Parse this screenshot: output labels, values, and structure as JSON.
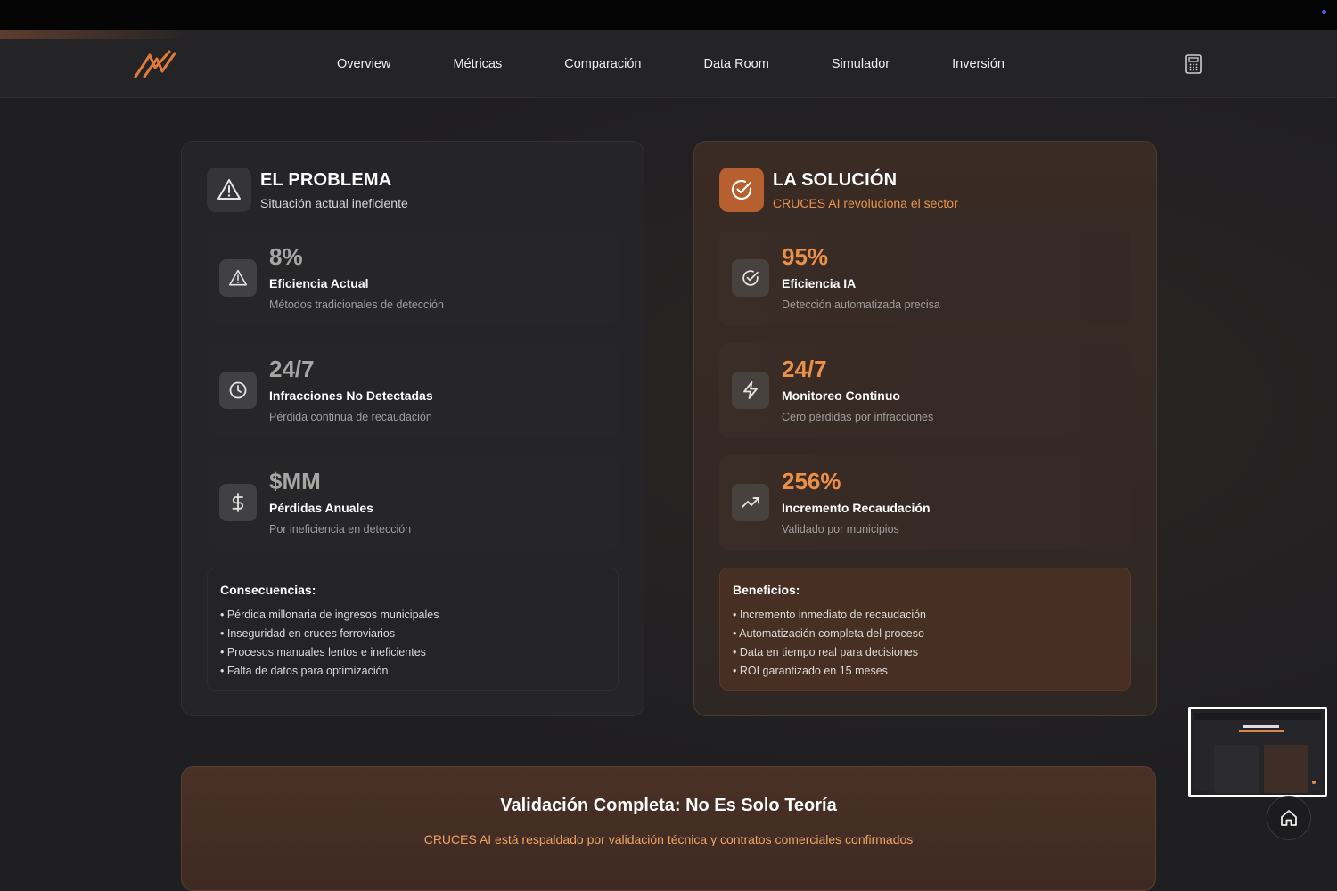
{
  "nav": {
    "links": [
      "Overview",
      "Métricas",
      "Comparación",
      "Data Room",
      "Simulador",
      "Inversión"
    ]
  },
  "problem": {
    "title": "EL PROBLEMA",
    "subtitle": "Situación actual ineficiente",
    "metrics": [
      {
        "value": "8%",
        "title": "Eficiencia Actual",
        "desc": "Métodos tradicionales de detección",
        "icon": "warning-icon"
      },
      {
        "value": "24/7",
        "title": "Infracciones No Detectadas",
        "desc": "Pérdida continua de recaudación",
        "icon": "clock-icon"
      },
      {
        "value": "$MM",
        "title": "Pérdidas Anuales",
        "desc": "Por ineficiencia en detección",
        "icon": "dollar-icon"
      }
    ],
    "list_title": "Consecuencias:",
    "list": [
      "• Pérdida millonaria de ingresos municipales",
      "• Inseguridad en cruces ferroviarios",
      "• Procesos manuales lentos e ineficientes",
      "• Falta de datos para optimización"
    ]
  },
  "solution": {
    "title": "LA SOLUCIÓN",
    "subtitle": "CRUCES AI revoluciona el sector",
    "metrics": [
      {
        "value": "95%",
        "title": "Eficiencia IA",
        "desc": "Detección automatizada precisa",
        "icon": "check-circle-icon"
      },
      {
        "value": "24/7",
        "title": "Monitoreo Continuo",
        "desc": "Cero pérdidas por infracciones",
        "icon": "lightning-icon"
      },
      {
        "value": "256%",
        "title": "Incremento Recaudación",
        "desc": "Validado por municipios",
        "icon": "trending-up-icon"
      }
    ],
    "list_title": "Beneficios:",
    "list": [
      "• Incremento inmediato de recaudación",
      "• Automatización completa del proceso",
      "• Data en tiempo real para decisiones",
      "• ROI garantizado en 15 meses"
    ]
  },
  "validation": {
    "title": "Validación Completa: No Es Solo Teoría",
    "subtitle": "CRUCES AI está respaldado por validación técnica y contratos comerciales confirmados"
  },
  "colors": {
    "accent": "#ec8f47",
    "background": "#1f1e21"
  }
}
